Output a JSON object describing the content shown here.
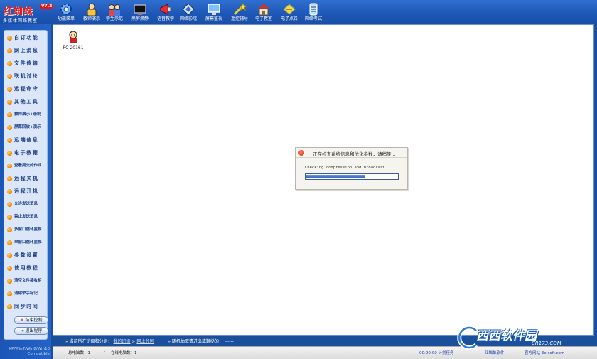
{
  "brand": {
    "title": "红蜘蛛",
    "version": "V7.2",
    "subtitle": "多媒体网络教室"
  },
  "toolbar": [
    {
      "label": "功能菜单",
      "icon": "gear-icon"
    },
    {
      "label": "教师演示",
      "icon": "teacher-icon"
    },
    {
      "label": "学生示范",
      "icon": "students-icon"
    },
    {
      "label": "黑屏肃静",
      "icon": "black-screen-icon"
    },
    {
      "label": "语音教学",
      "icon": "megaphone-icon"
    },
    {
      "label": "网络影院",
      "icon": "film-icon"
    },
    {
      "label": "屏幕监视",
      "icon": "monitor-icon"
    },
    {
      "label": "遥控辅导",
      "icon": "wand-icon"
    },
    {
      "label": "电子教室",
      "icon": "classroom-icon"
    },
    {
      "label": "电子点名",
      "icon": "rollcall-icon"
    },
    {
      "label": "网络考试",
      "icon": "exam-icon"
    }
  ],
  "sidebar": {
    "items": [
      "自订功能",
      "网上消息",
      "文件传输",
      "联机讨论",
      "远程命令",
      "其他工具",
      "教师演示+录制",
      "屏幕回放+演示",
      "远端信息",
      "电子教鞭",
      "查看提交的作业",
      "远程关机",
      "远程开机",
      "允许发送消息",
      "禁止发送消息",
      "多窗口循环监视",
      "单窗口循环监视",
      "参数设置",
      "使用教程",
      "清空文件接收柜",
      "清除举手标记",
      "同步时间"
    ],
    "end_control": "结束控制",
    "exit_program": "退出程序",
    "compat_line1": "XP/Win7/Win8/Win10",
    "compat_line2": "Compatible"
  },
  "computer": {
    "name": "PC-20161"
  },
  "dialog": {
    "title": "正在检查系统信息和优化参数，请稍等...",
    "status": "Checking compression and broadcast...",
    "progress": 0.65
  },
  "pathbar": {
    "prefix": "» 当前所在班级和分组：",
    "class_link": "我的班级",
    "sep": "> ",
    "group_link": "网上邻居",
    "mid": "» 随机抽取请进出或鞭挞的：",
    "value": "------"
  },
  "statusbar": {
    "total": "总电脑数：1",
    "dash": "-",
    "online": "在线电脑数：1",
    "timer": "00:00:00 计划任务",
    "link1": "红蜘蛛软件",
    "link2": "官方网站 3e-soft.com"
  },
  "watermark": {
    "title": "西西软件园",
    "url": "CR173.COM"
  },
  "colors": {
    "accent": "#1d56b5",
    "brand_red": "#e21c1c",
    "progress": "#2e5db6"
  }
}
